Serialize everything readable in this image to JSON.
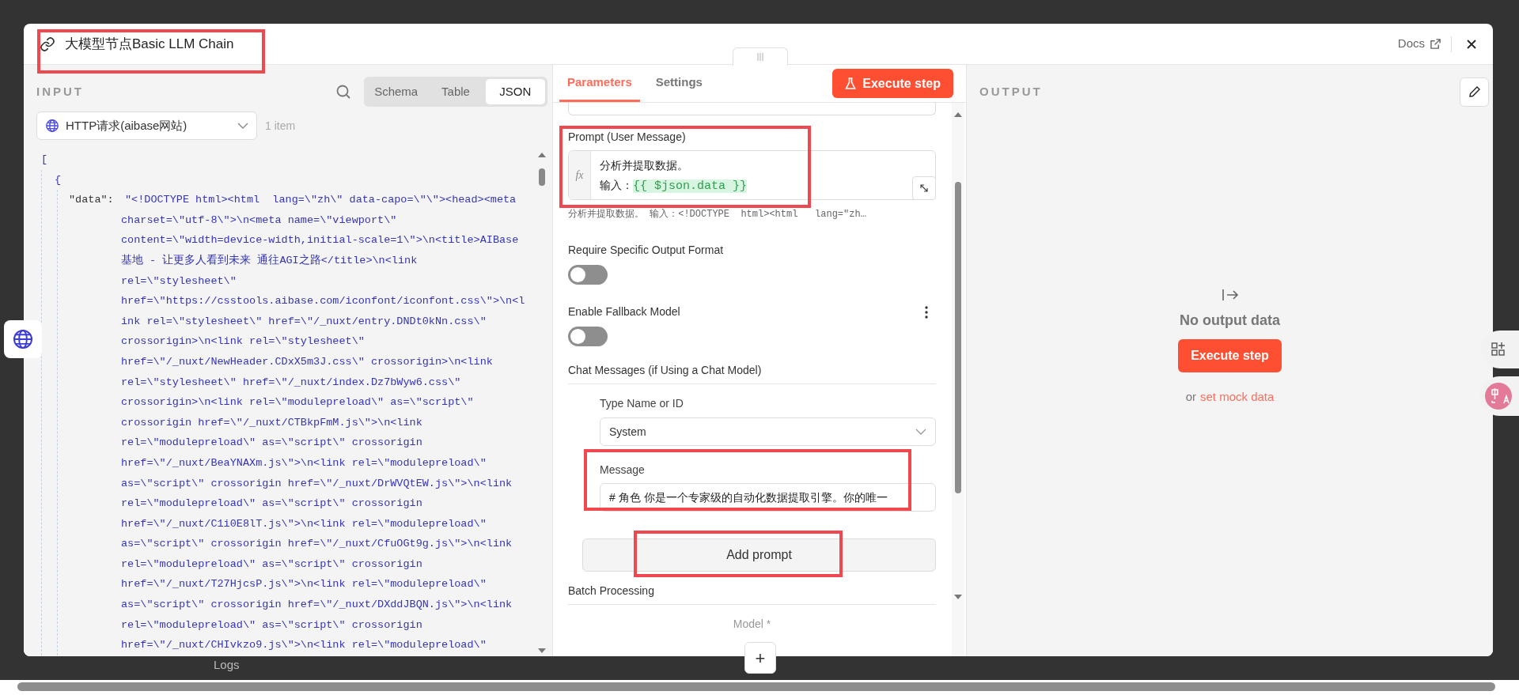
{
  "window": {
    "title": "大模型节点Basic LLM Chain",
    "docs_link": "Docs"
  },
  "background": {
    "logs_label": "Logs"
  },
  "input_panel": {
    "heading": "INPUT",
    "view_tabs": [
      {
        "label": "Schema",
        "selected": false
      },
      {
        "label": "Table",
        "selected": false
      },
      {
        "label": "JSON",
        "selected": true
      }
    ],
    "source_select": {
      "value": "HTTP请求(aibase网站)"
    },
    "item_count": "1 item",
    "json_view": {
      "open_bracket": "[",
      "open_brace": "{",
      "key": "\"data\":",
      "value_lines": [
        "\"<!DOCTYPE html><html  lang=\\\"zh\\\" data-capo=\\\"\\\"><head><meta",
        "charset=\\\"utf-8\\\">\\n<meta name=\\\"viewport\\\"",
        "content=\\\"width=device-width,initial-scale=1\\\">\\n<title>AIBase",
        "基地 - 让更多人看到未来 通往AGI之路</title>\\n<link",
        "rel=\\\"stylesheet\\\"",
        "href=\\\"https://csstools.aibase.com/iconfont/iconfont.css\\\">\\n<l",
        "ink rel=\\\"stylesheet\\\" href=\\\"/_nuxt/entry.DNDt0kNn.css\\\"",
        "crossorigin>\\n<link rel=\\\"stylesheet\\\"",
        "href=\\\"/_nuxt/NewHeader.CDxX5m3J.css\\\" crossorigin>\\n<link",
        "rel=\\\"stylesheet\\\" href=\\\"/_nuxt/index.Dz7bWyw6.css\\\"",
        "crossorigin>\\n<link rel=\\\"modulepreload\\\" as=\\\"script\\\"",
        "crossorigin href=\\\"/_nuxt/CTBkpFmM.js\\\">\\n<link",
        "rel=\\\"modulepreload\\\" as=\\\"script\\\" crossorigin",
        "href=\\\"/_nuxt/BeaYNAXm.js\\\">\\n<link rel=\\\"modulepreload\\\"",
        "as=\\\"script\\\" crossorigin href=\\\"/_nuxt/DrWVQtEW.js\\\">\\n<link",
        "rel=\\\"modulepreload\\\" as=\\\"script\\\" crossorigin",
        "href=\\\"/_nuxt/C1i0E8lT.js\\\">\\n<link rel=\\\"modulepreload\\\"",
        "as=\\\"script\\\" crossorigin href=\\\"/_nuxt/CfuOGt9g.js\\\">\\n<link",
        "rel=\\\"modulepreload\\\" as=\\\"script\\\" crossorigin",
        "href=\\\"/_nuxt/T27HjcsP.js\\\">\\n<link rel=\\\"modulepreload\\\"",
        "as=\\\"script\\\" crossorigin href=\\\"/_nuxt/DXddJBQN.js\\\">\\n<link",
        "rel=\\\"modulepreload\\\" as=\\\"script\\\" crossorigin",
        "href=\\\"/_nuxt/CHIvkzo9.js\\\">\\n<link rel=\\\"modulepreload\\\""
      ]
    }
  },
  "parameters_panel": {
    "tabs": [
      {
        "label": "Parameters",
        "selected": true
      },
      {
        "label": "Settings",
        "selected": false
      }
    ],
    "execute_button": "Execute step",
    "prompt": {
      "label": "Prompt (User Message)",
      "gutter_label": "fx",
      "lines": [
        [
          {
            "kind": "plain",
            "text": "分析并提取数据。"
          }
        ],
        [
          {
            "kind": "plain",
            "text": "输入："
          },
          {
            "kind": "expression",
            "text": "{{ $json.data }}"
          }
        ]
      ],
      "preview": "分析并提取数据。 输入：<!DOCTYPE  html><html   lang=\"zh…"
    },
    "toggles": [
      {
        "label": "Require Specific Output Format",
        "on": false,
        "has_menu": false
      },
      {
        "label": "Enable Fallback Model",
        "on": false,
        "has_menu": true
      }
    ],
    "chat_messages": {
      "heading": "Chat Messages (if Using a Chat Model)",
      "type_field": {
        "label": "Type Name or ID",
        "value": "System"
      },
      "message_field": {
        "label": "Message",
        "value": "# 角色  你是一个专家级的自动化数据提取引擎。你的唯一"
      },
      "add_button": "Add prompt"
    },
    "batch_heading": "Batch Processing",
    "model_label": "Model *",
    "add_model_button": "+"
  },
  "output_panel": {
    "heading": "OUTPUT",
    "empty_title": "No output data",
    "execute_button": "Execute step",
    "or_text": "or",
    "mock_link": "set mock data"
  }
}
